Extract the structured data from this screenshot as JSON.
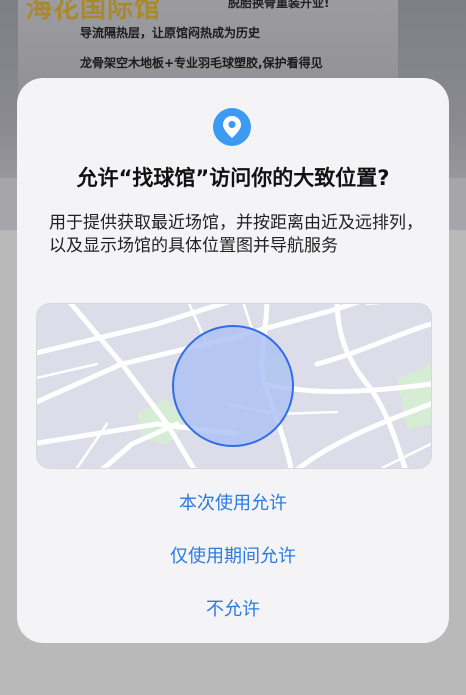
{
  "background": {
    "banner_title": "海花国际馆",
    "banner_subtitle": "脱胎换骨重装开业!",
    "banner_line1": "导流隔热层，让原馆闷热成为历史",
    "banner_line2": "龙骨架空木地板+专业羽毛球塑胶,保护看得见"
  },
  "dialog": {
    "icon": "location-pin-icon",
    "title": "允许“找球馆”访问你的大致位置?",
    "description": "用于提供获取最近场馆，并按距离由近及远排列，以及显示场馆的具体位置图并导航服务",
    "map_icon": "approximate-location-circle",
    "actions": {
      "allow_once": "本次使用允许",
      "allow_while_using": "仅使用期间允许",
      "deny": "不允许"
    }
  },
  "colors": {
    "accent": "#2b7be0",
    "badge": "#3d9af2",
    "dialog_bg": "#f4f4f6",
    "location_fill": "#aec2f4",
    "location_stroke": "#2f6ee6"
  }
}
